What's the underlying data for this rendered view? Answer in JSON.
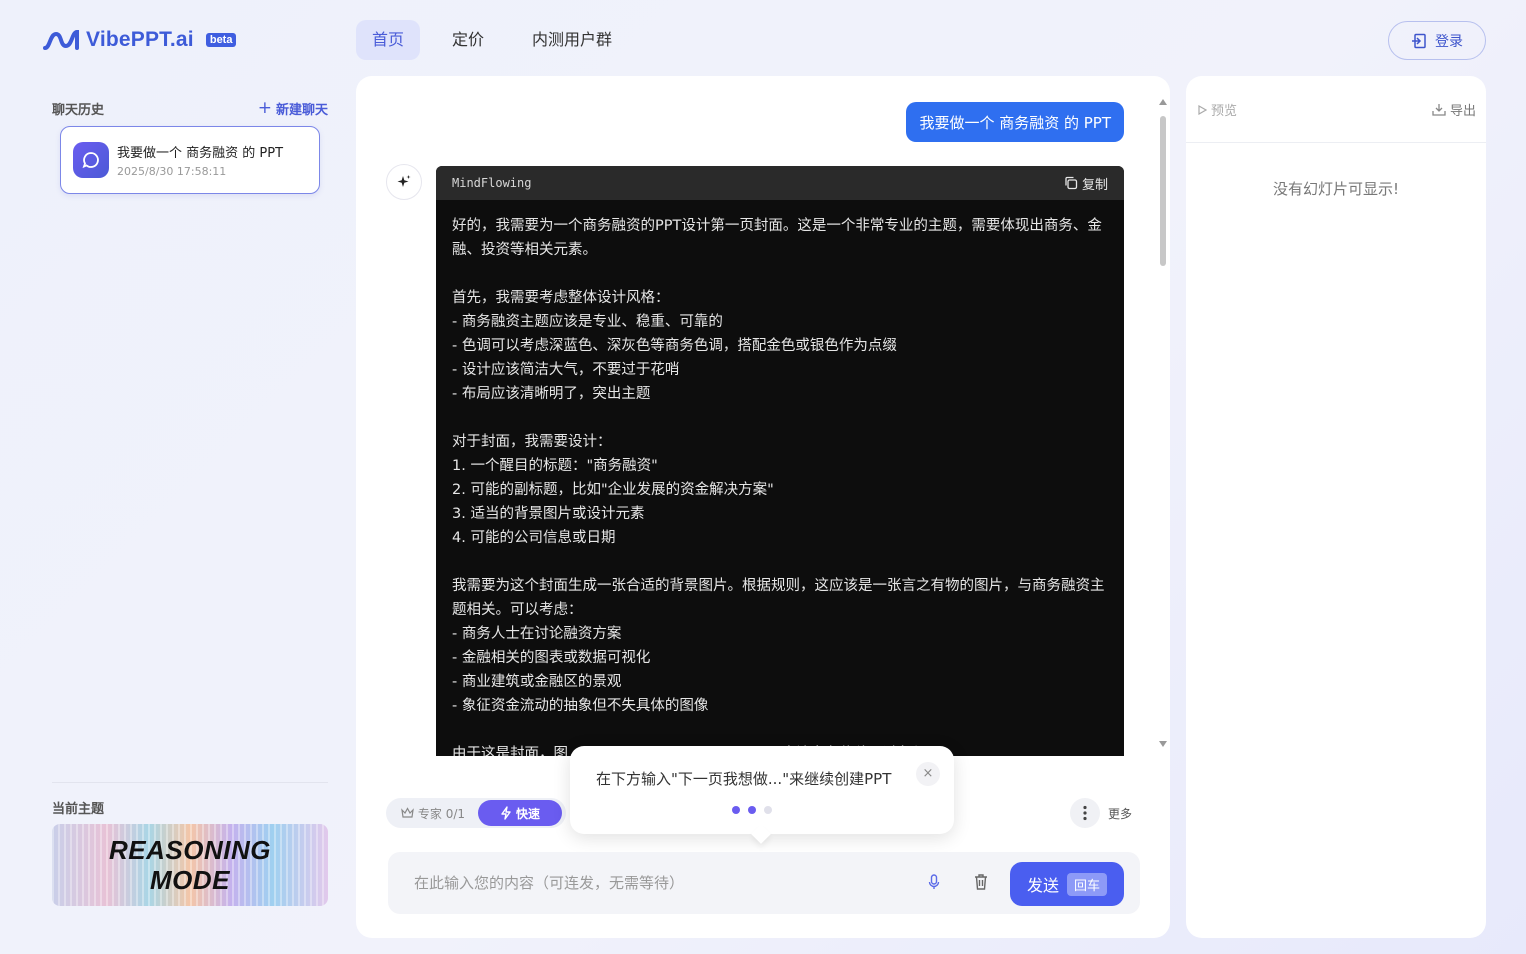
{
  "app": {
    "name": "VibePPT.ai",
    "badge": "beta"
  },
  "nav": {
    "items": [
      {
        "label": "首页",
        "active": true
      },
      {
        "label": "定价",
        "active": false
      },
      {
        "label": "内测用户群",
        "active": false
      }
    ],
    "login_label": "登录"
  },
  "sidebar": {
    "title": "聊天历史",
    "new_chat_label": "新建聊天",
    "chats": [
      {
        "title": "我要做一个 商务融资 的 PPT",
        "time": "2025/8/30 17:58:11",
        "icon": "chat-bubble-icon"
      }
    ],
    "theme_label": "当前主题",
    "theme_name_line1": "REASONING",
    "theme_name_line2": "MODE"
  },
  "chat": {
    "user_message": "我要做一个 商务融资 的 PPT",
    "code_block": {
      "language": "MindFlowing",
      "copy_label": "复制",
      "text": "好的，我需要为一个商务融资的PPT设计第一页封面。这是一个非常专业的主题，需要体现出商务、金融、投资等相关元素。\n\n首先，我需要考虑整体设计风格：\n- 商务融资主题应该是专业、稳重、可靠的\n- 色调可以考虑深蓝色、深灰色等商务色调，搭配金色或银色作为点缀\n- 设计应该简洁大气，不要过于花哨\n- 布局应该清晰明了，突出主题\n\n对于封面，我需要设计：\n1. 一个醒目的标题：\"商务融资\"\n2. 可能的副标题，比如\"企业发展的资金解决方案\"\n3. 适当的背景图片或设计元素\n4. 可能的公司信息或日期\n\n我需要为这个封面生成一张合适的背景图片。根据规则，这应该是一张言之有物的图片，与商务融资主题相关。可以考虑：\n- 商务人士在讨论融资方案\n- 金融相关的图表或数据可视化\n- 商业建筑或金融区的景观\n- 象征资金流动的抽象但不失具体的图像\n\n由于这是封面，图                                        ……应该向左偏移，避免与"
    },
    "mode": {
      "expert_label": "专家 0/1",
      "fast_label": "快速"
    },
    "more_label": "更多",
    "popup": {
      "text": "在下方输入\"下一页我想做...\"来继续创建PPT",
      "close": "×"
    },
    "input": {
      "placeholder": "在此输入您的内容（可连发，无需等待）",
      "send_label": "发送",
      "send_hint": "回车"
    }
  },
  "preview": {
    "preview_label": "预览",
    "export_label": "导出",
    "empty_text": "没有幻灯片可显示!"
  },
  "colors": {
    "accent": "#4a5ef0",
    "user_bubble": "#2f6ff0",
    "code_bg": "#0d0d0d"
  }
}
